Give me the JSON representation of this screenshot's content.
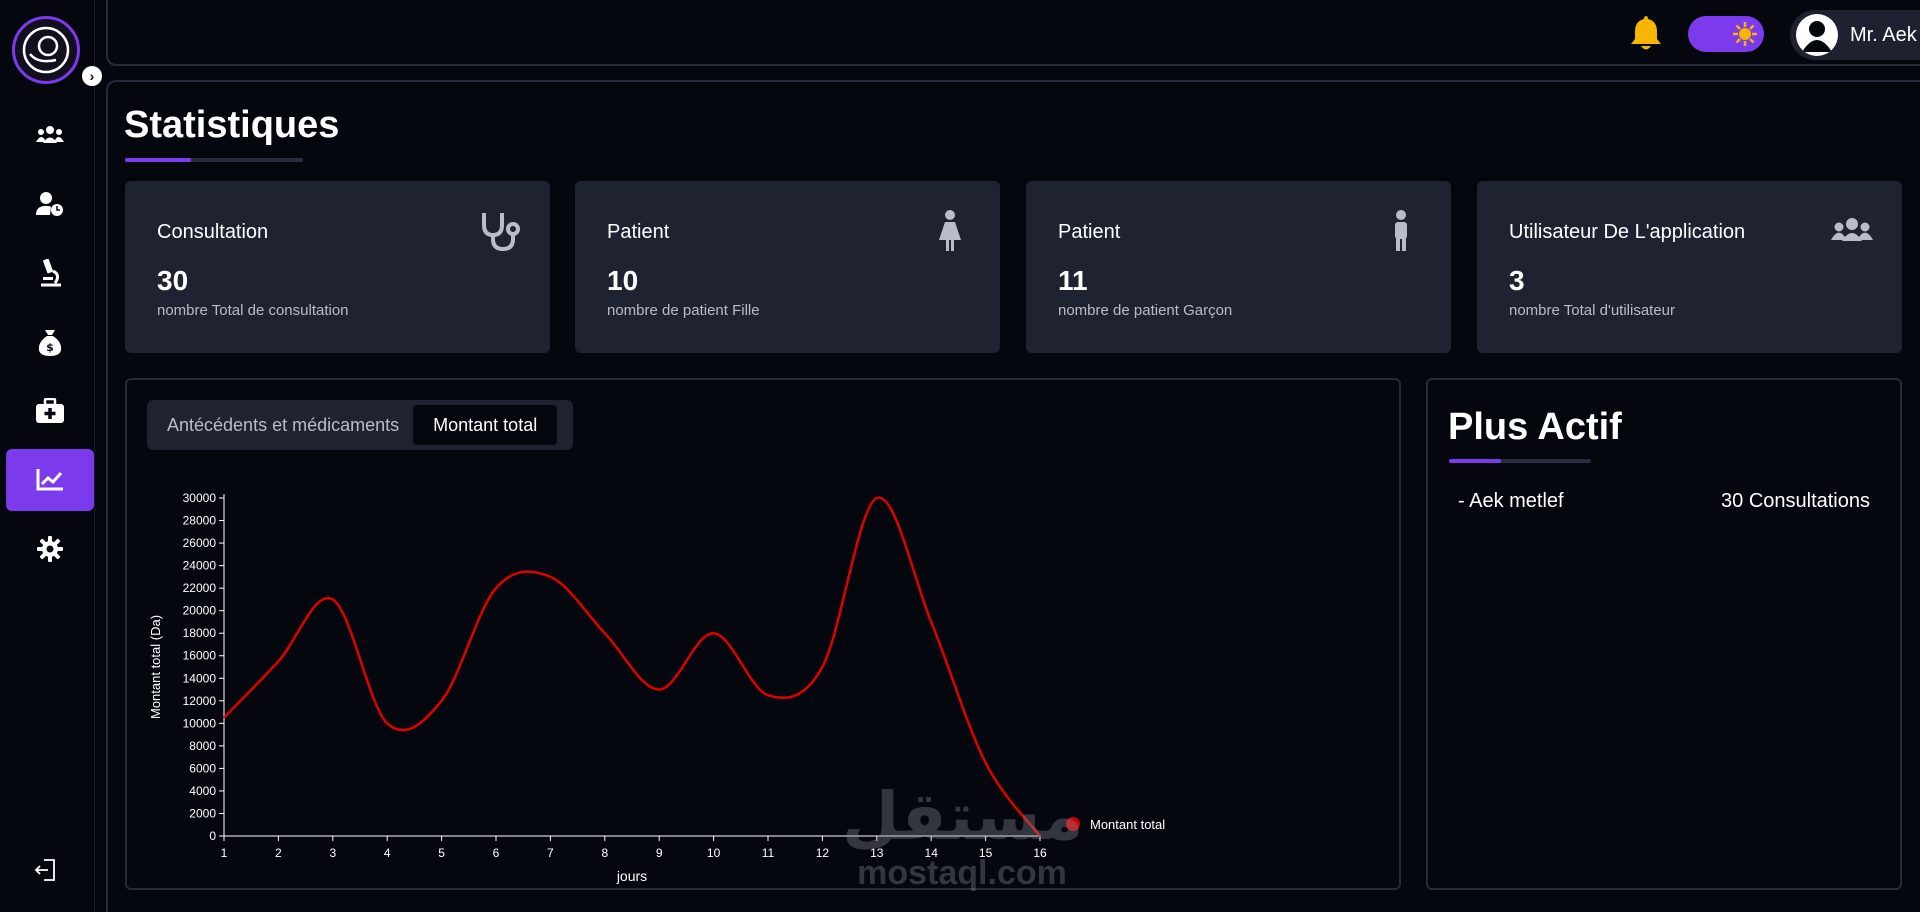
{
  "sidebar": {
    "items": [
      {
        "icon": "users-icon",
        "active": false
      },
      {
        "icon": "user-clock-icon",
        "active": false
      },
      {
        "icon": "microscope-icon",
        "active": false
      },
      {
        "icon": "money-bag-icon",
        "active": false
      },
      {
        "icon": "medical-kit-icon",
        "active": false
      },
      {
        "icon": "chart-line-icon",
        "active": true
      },
      {
        "icon": "gear-icon",
        "active": false
      }
    ]
  },
  "header": {
    "user_name": "Mr. Aek metlef"
  },
  "page": {
    "title": "Statistiques"
  },
  "cards": [
    {
      "title": "Consultation",
      "value": "30",
      "desc": "nombre Total de consultation",
      "icon": "stethoscope-icon"
    },
    {
      "title": "Patient",
      "value": "10",
      "desc": "nombre de patient Fille",
      "icon": "female-icon"
    },
    {
      "title": "Patient",
      "value": "11",
      "desc": "nombre de patient Garçon",
      "icon": "male-icon"
    },
    {
      "title": "Utilisateur De L'application",
      "value": "3",
      "desc": "nombre Total d'utilisateur",
      "icon": "users-icon"
    }
  ],
  "tabs": [
    {
      "label": "Antécédents et médicaments",
      "active": false
    },
    {
      "label": "Montant total",
      "active": true
    }
  ],
  "chart_data": {
    "type": "line",
    "xlabel": "jours",
    "ylabel": "Montant total (Da)",
    "x": [
      1,
      2,
      3,
      4,
      5,
      6,
      7,
      8,
      9,
      10,
      11,
      12,
      13,
      14,
      15,
      16
    ],
    "series": [
      {
        "name": "Montant total",
        "color": "#e00000",
        "values": [
          10500,
          15500,
          21000,
          10000,
          12000,
          22000,
          23000,
          18000,
          13000,
          18000,
          12500,
          15000,
          30000,
          19000,
          6500,
          0
        ]
      }
    ],
    "xlim": [
      1,
      16
    ],
    "ylim": [
      0,
      30000
    ],
    "yticks": [
      0,
      2000,
      4000,
      6000,
      8000,
      10000,
      12000,
      14000,
      16000,
      18000,
      20000,
      22000,
      24000,
      26000,
      28000,
      30000
    ],
    "legend": "right"
  },
  "active": {
    "title": "Plus Actif",
    "rows": [
      {
        "name": "- Aek metlef",
        "count": "30 Consultations"
      }
    ]
  },
  "watermark": {
    "text": "mostaql.com",
    "arabic": "مستقل"
  }
}
